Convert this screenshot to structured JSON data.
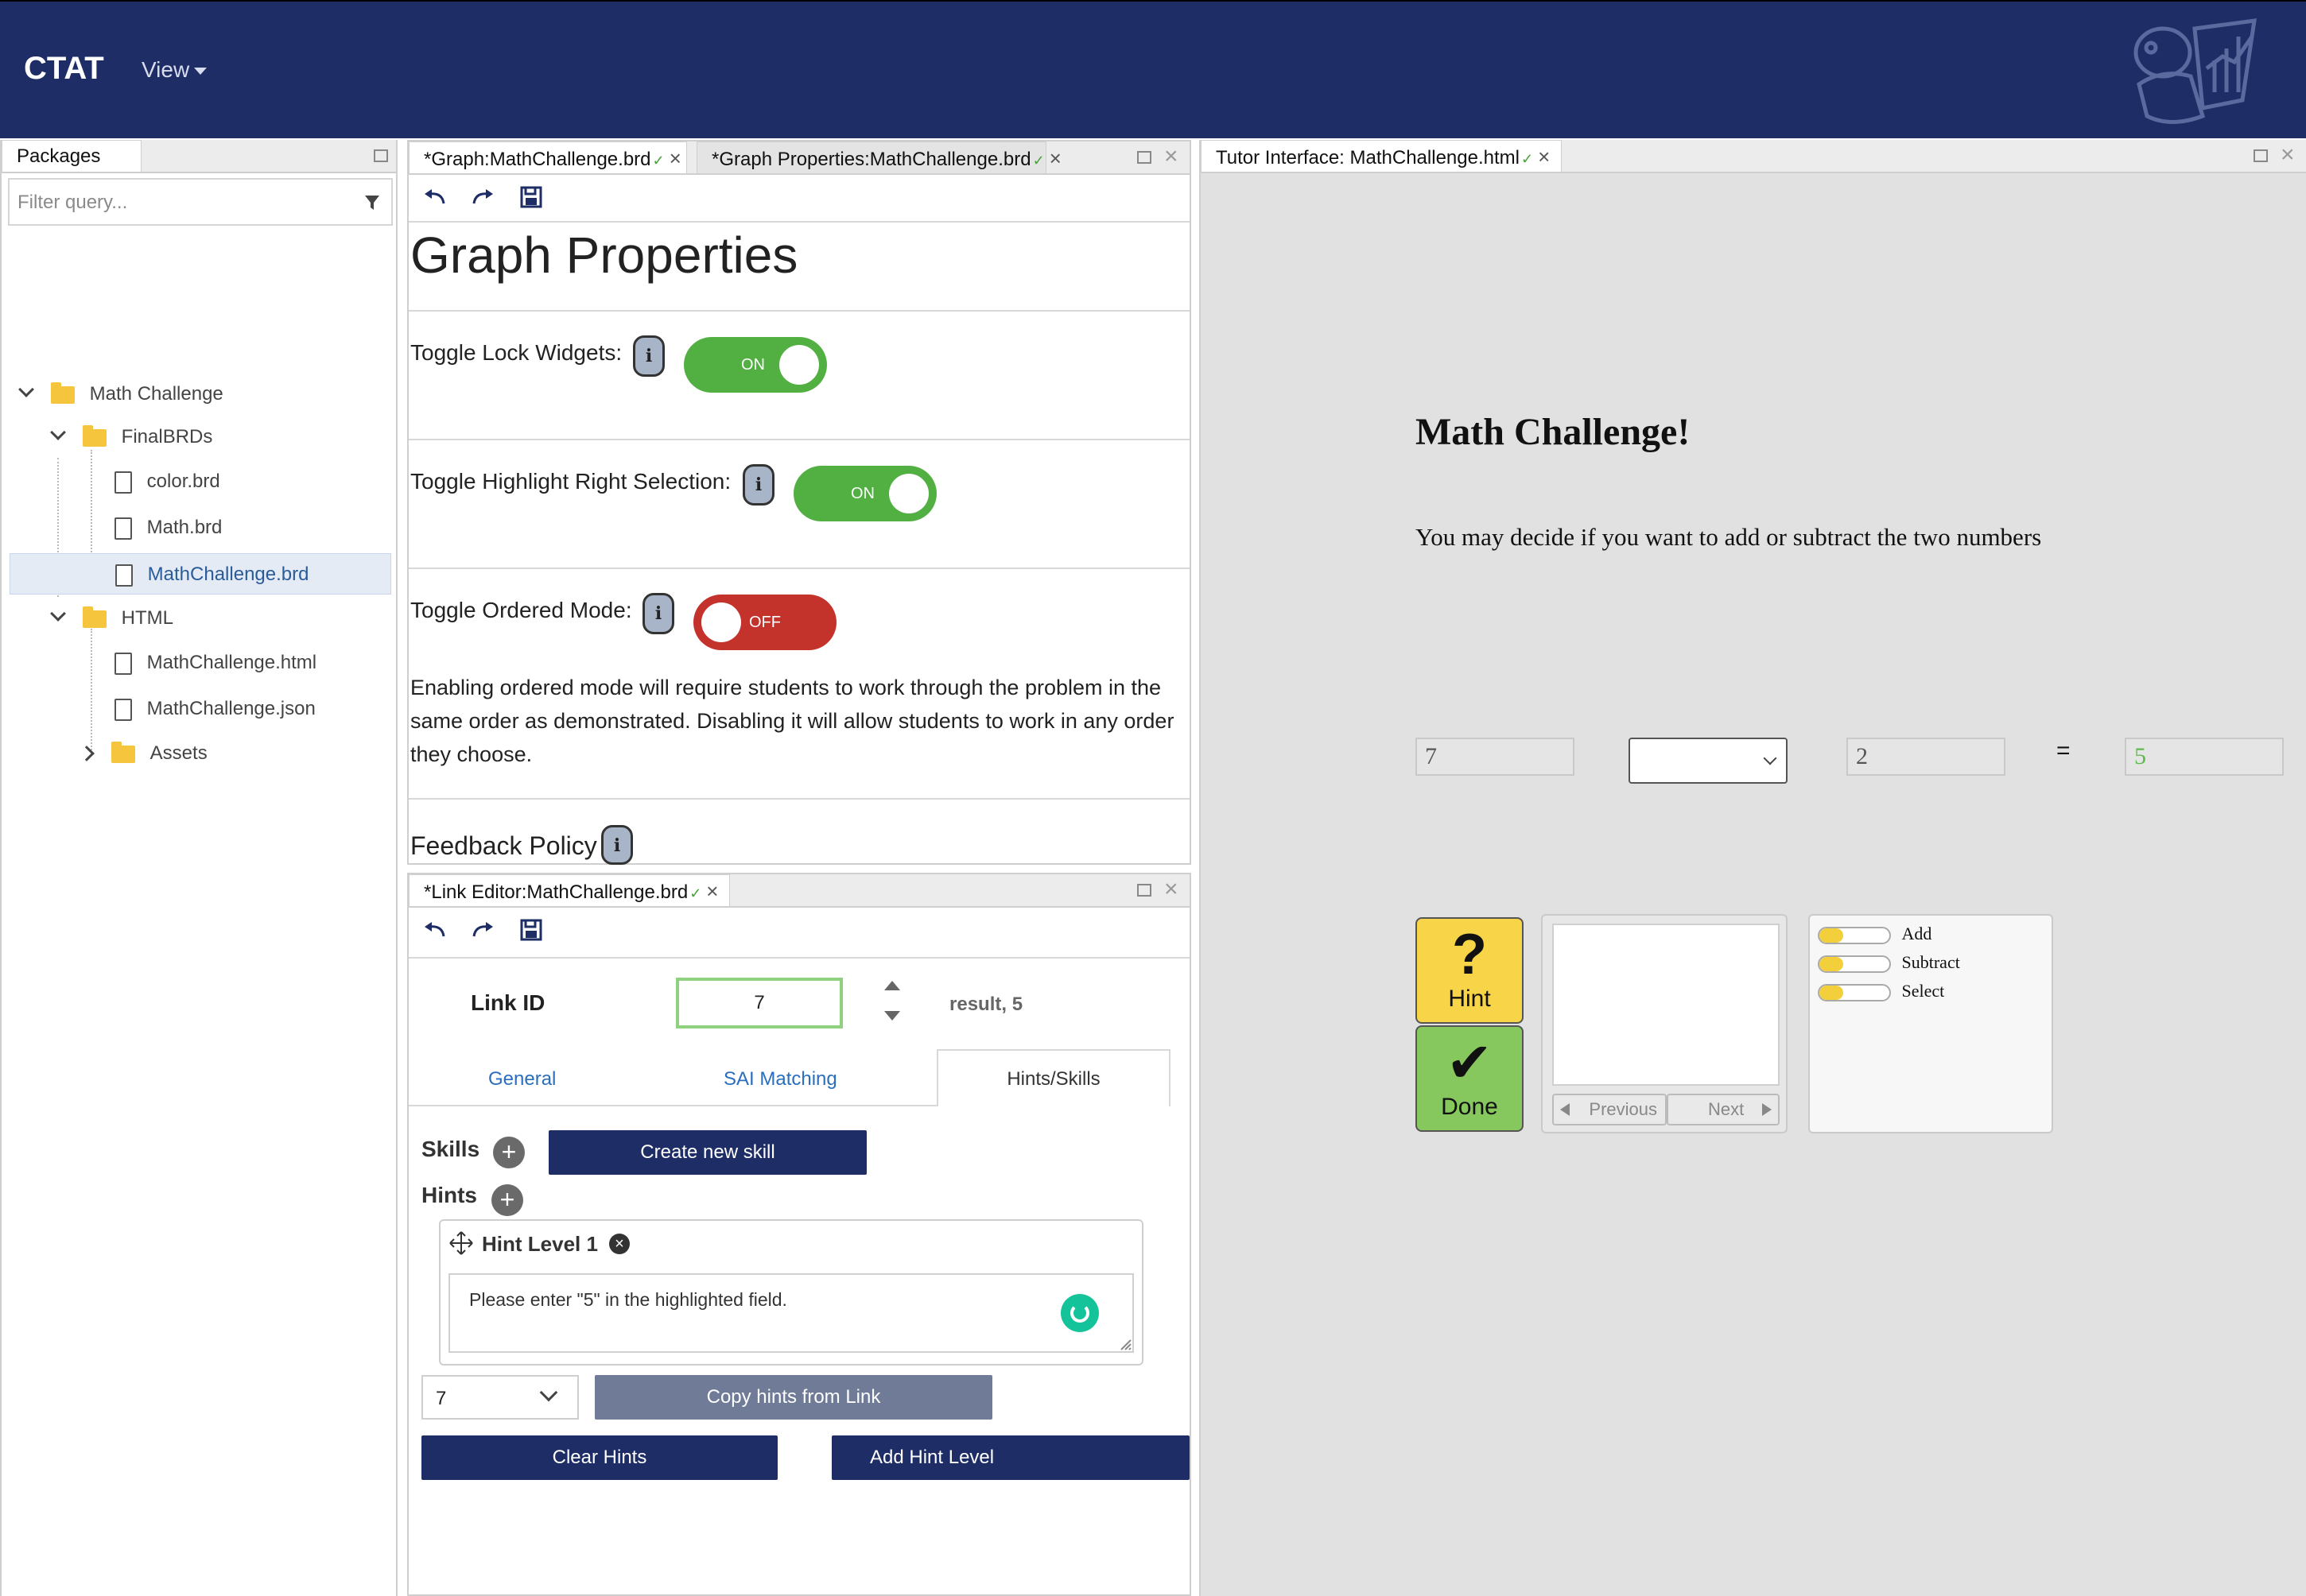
{
  "navbar": {
    "brand": "CTAT",
    "view_menu": "View",
    "logo_icon": "ctat-mascot-logo",
    "bg_color": "#1e2d65"
  },
  "packages": {
    "tab_label": "Packages",
    "filter_placeholder": "Filter query...",
    "tree": [
      {
        "label": "Math Challenge",
        "type": "folder",
        "expanded": true
      },
      {
        "label": "FinalBRDs",
        "type": "folder",
        "expanded": true
      },
      {
        "label": "color.brd",
        "type": "file"
      },
      {
        "label": "Math.brd",
        "type": "file"
      },
      {
        "label": "MathChallenge.brd",
        "type": "file",
        "selected": true
      },
      {
        "label": "HTML",
        "type": "folder",
        "expanded": true
      },
      {
        "label": "MathChallenge.html",
        "type": "file"
      },
      {
        "label": "MathChallenge.json",
        "type": "file"
      },
      {
        "label": "Assets",
        "type": "folder",
        "expanded": false
      }
    ]
  },
  "graph_panel": {
    "tabs": [
      {
        "label": "*Graph:MathChallenge.brd",
        "active": true
      },
      {
        "label": "*Graph Properties:MathChallenge.brd",
        "active": false
      }
    ],
    "heading": "Graph Properties",
    "properties": [
      {
        "label": "Toggle Lock Widgets:",
        "state": "ON"
      },
      {
        "label": "Toggle Highlight Right Selection:",
        "state": "ON"
      },
      {
        "label": "Toggle Ordered Mode:",
        "state": "OFF"
      }
    ],
    "info_glyph": "i",
    "ordered_mode_description": "Enabling ordered mode will require students to work through the problem in the same order as demonstrated. Disabling it will allow students to work in any order they choose.",
    "feedback_policy": "Feedback Policy"
  },
  "link_editor": {
    "tab_label": "*Link Editor:MathChallenge.brd",
    "link_id_label": "Link ID",
    "link_id_value": "7",
    "link_summary": "result, 5",
    "tabs": [
      "General",
      "SAI Matching",
      "Hints/Skills"
    ],
    "active_tab": "Hints/Skills",
    "skills_label": "Skills",
    "create_skill_button": "Create new skill",
    "hints_label": "Hints",
    "hint_level_title": "Hint Level 1",
    "hint_text": "Please enter \"5\" in the highlighted field.",
    "link_select_value": "7",
    "copy_hints_button": "Copy hints from Link",
    "clear_hints_button": "Clear Hints",
    "add_hint_level_button": "Add Hint Level"
  },
  "tutor": {
    "tab_label": "Tutor Interface: MathChallenge.html",
    "title": "Math Challenge!",
    "instructions": "You may decide if you want to add or subtract the two numbers",
    "operand1": "7",
    "operator_value": "",
    "operand2": "2",
    "equals": "=",
    "result": "5",
    "result_color": "#5fb94c",
    "hint_button": "Hint",
    "hint_glyph": "?",
    "done_button": "Done",
    "done_glyph": "✔",
    "previous_button": "Previous",
    "next_button": "Next",
    "radio_options": [
      "Add",
      "Subtract",
      "Select"
    ]
  }
}
